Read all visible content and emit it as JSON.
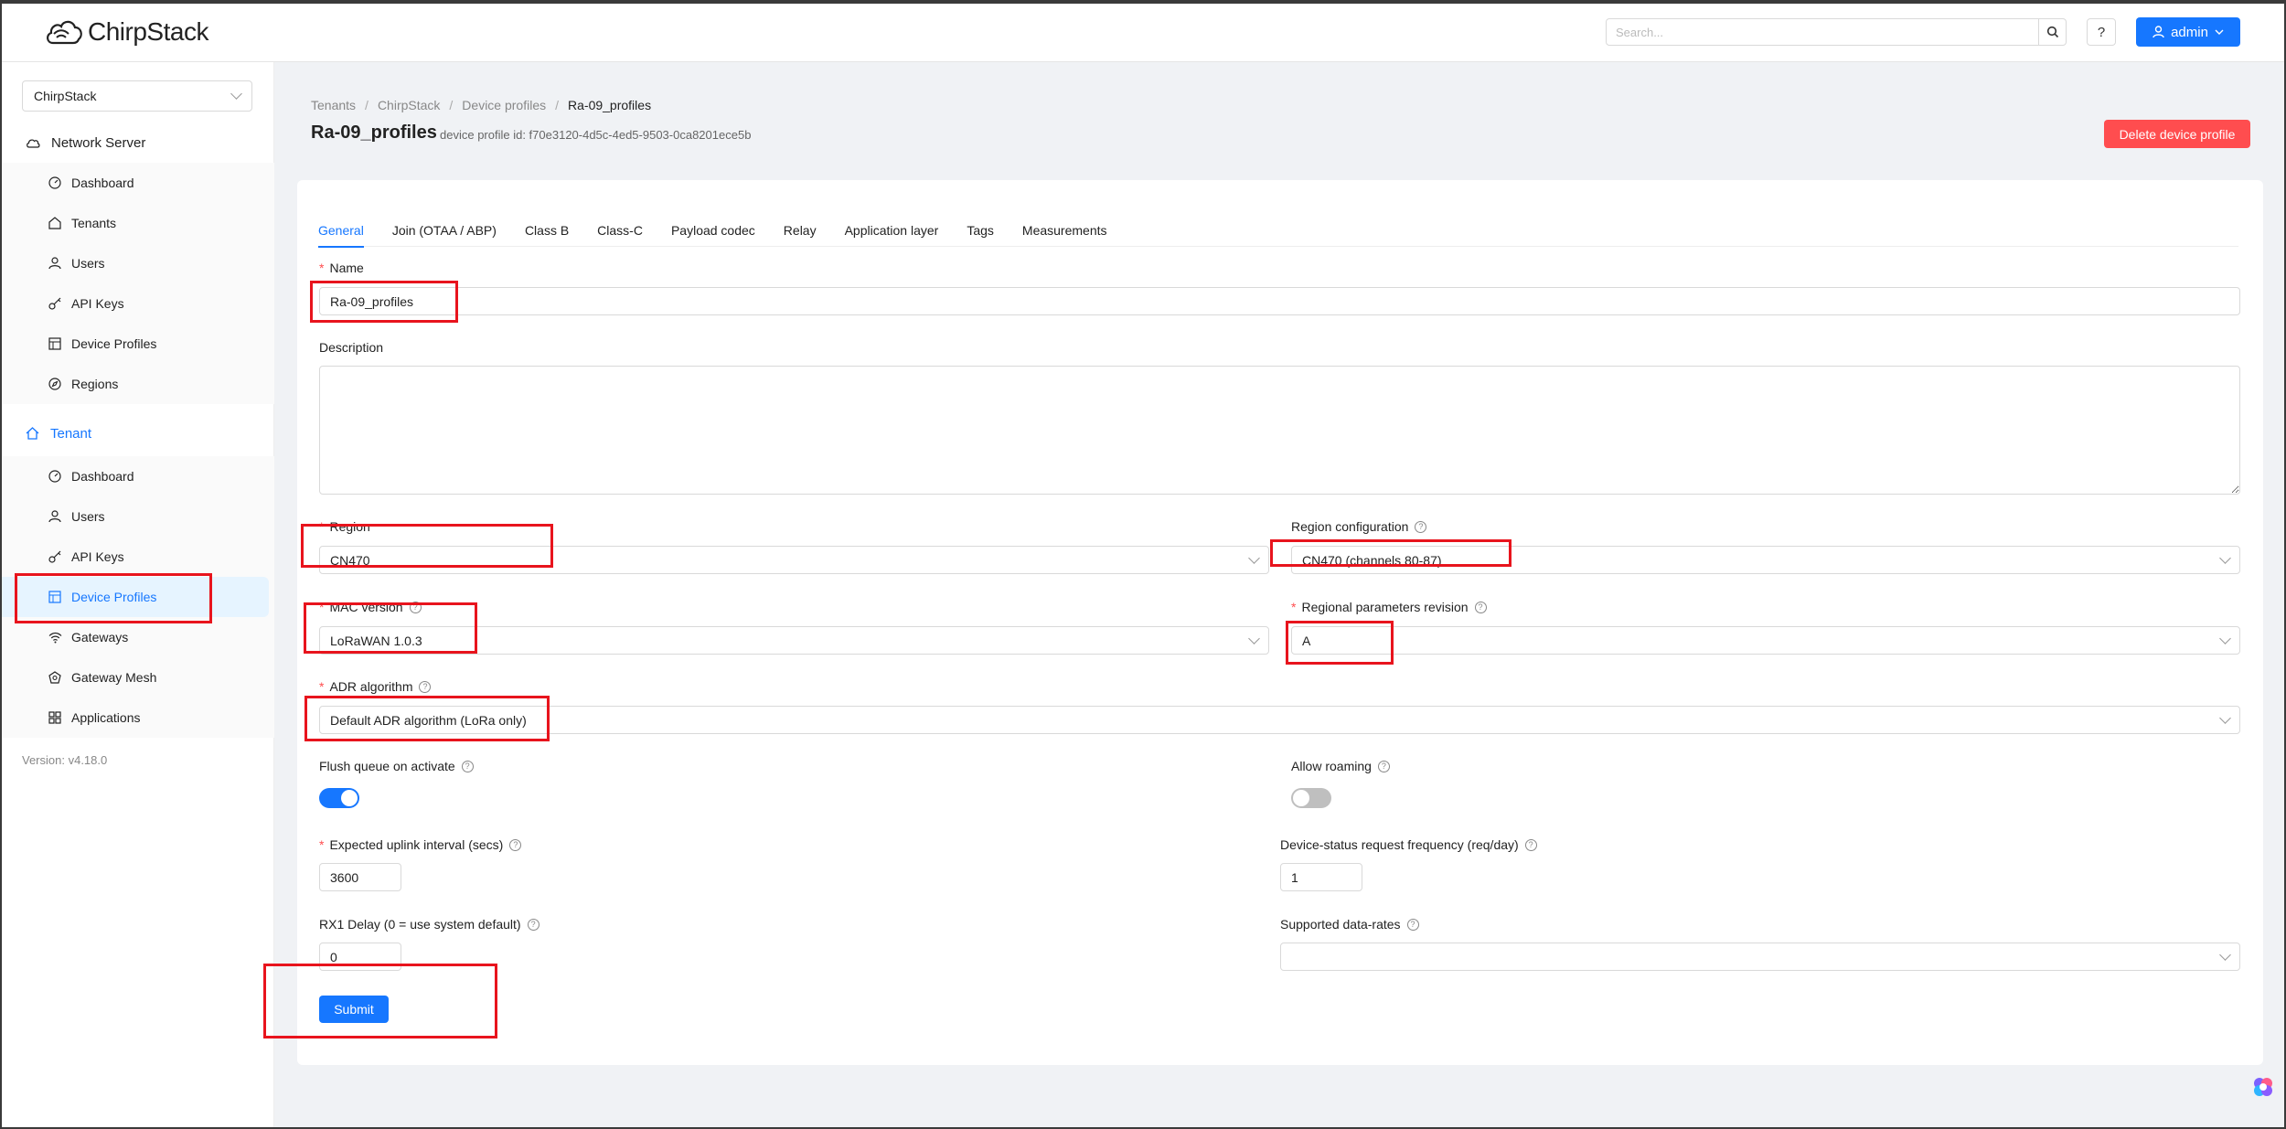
{
  "app": {
    "logo_text": "ChirpStack"
  },
  "header": {
    "search_placeholder": "Search...",
    "help_label": "?",
    "user_label": "admin"
  },
  "sidebar": {
    "tenant_select": "ChirpStack",
    "network_server_label": "Network Server",
    "network_items": [
      {
        "label": "Dashboard",
        "icon": "dashboard-icon"
      },
      {
        "label": "Tenants",
        "icon": "tenants-icon"
      },
      {
        "label": "Users",
        "icon": "user-icon"
      },
      {
        "label": "API Keys",
        "icon": "key-icon"
      },
      {
        "label": "Device Profiles",
        "icon": "device-profile-icon"
      },
      {
        "label": "Regions",
        "icon": "compass-icon"
      }
    ],
    "tenant_label": "Tenant",
    "tenant_items": [
      {
        "label": "Dashboard",
        "icon": "dashboard-icon"
      },
      {
        "label": "Users",
        "icon": "user-icon"
      },
      {
        "label": "API Keys",
        "icon": "key-icon"
      },
      {
        "label": "Device Profiles",
        "icon": "device-profile-icon",
        "selected": true
      },
      {
        "label": "Gateways",
        "icon": "wifi-icon"
      },
      {
        "label": "Gateway Mesh",
        "icon": "mesh-icon"
      },
      {
        "label": "Applications",
        "icon": "apps-icon"
      }
    ],
    "version": "Version: v4.18.0"
  },
  "breadcrumb": [
    "Tenants",
    "ChirpStack",
    "Device profiles",
    "Ra-09_profiles"
  ],
  "page": {
    "title": "Ra-09_profiles",
    "subtitle": "device profile id: f70e3120-4d5c-4ed5-9503-0ca8201ece5b",
    "delete_label": "Delete device profile"
  },
  "tabs": [
    "General",
    "Join (OTAA / ABP)",
    "Class B",
    "Class-C",
    "Payload codec",
    "Relay",
    "Application layer",
    "Tags",
    "Measurements"
  ],
  "form": {
    "name_label": "Name",
    "name_value": "Ra-09_profiles",
    "description_label": "Description",
    "description_value": "",
    "region_label": "Region",
    "region_value": "CN470",
    "region_config_label": "Region configuration",
    "region_config_value": "CN470 (channels 80-87)",
    "mac_version_label": "MAC version",
    "mac_version_value": "LoRaWAN 1.0.3",
    "reg_params_label": "Regional parameters revision",
    "reg_params_value": "A",
    "adr_label": "ADR algorithm",
    "adr_value": "Default ADR algorithm (LoRa only)",
    "flush_label": "Flush queue on activate",
    "flush_on": true,
    "roaming_label": "Allow roaming",
    "roaming_on": false,
    "uplink_label": "Expected uplink interval (secs)",
    "uplink_value": "3600",
    "devstatus_label": "Device-status request frequency (req/day)",
    "devstatus_value": "1",
    "rx1_label": "RX1 Delay (0 = use system default)",
    "rx1_value": "0",
    "datarates_label": "Supported data-rates",
    "datarates_value": "",
    "submit_label": "Submit"
  },
  "colors": {
    "primary": "#1677ff",
    "danger": "#ff4d4f",
    "annotation": "#e8141d"
  }
}
